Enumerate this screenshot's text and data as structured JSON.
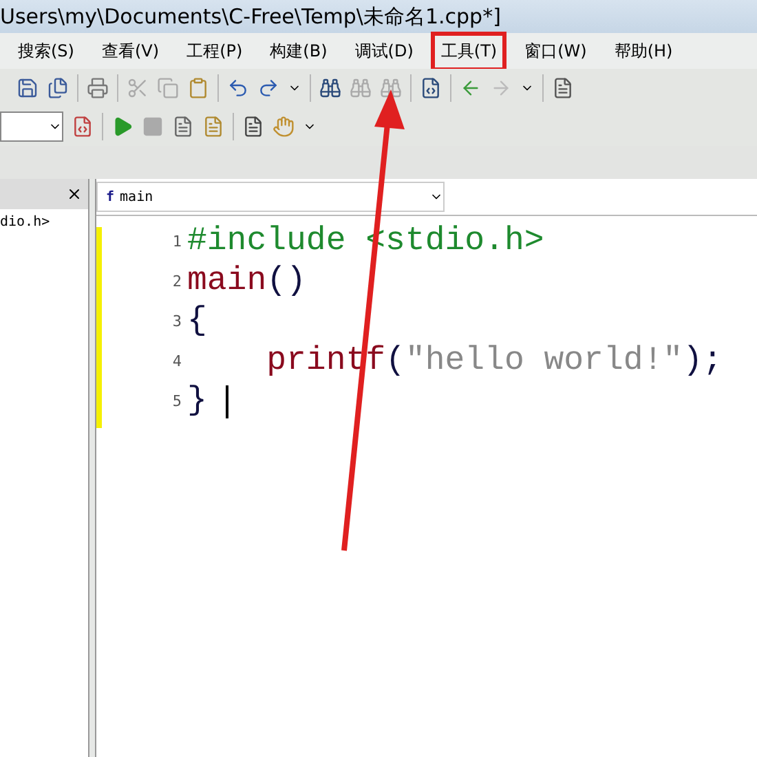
{
  "window": {
    "title": "Users\\my\\Documents\\C-Free\\Temp\\未命名1.cpp*]"
  },
  "menu": [
    {
      "label": "搜索(S)",
      "highlighted": false
    },
    {
      "label": "查看(V)",
      "highlighted": false
    },
    {
      "label": "工程(P)",
      "highlighted": false
    },
    {
      "label": "构建(B)",
      "highlighted": false
    },
    {
      "label": "调试(D)",
      "highlighted": false
    },
    {
      "label": "工具(T)",
      "highlighted": true
    },
    {
      "label": "窗口(W)",
      "highlighted": false
    },
    {
      "label": "帮助(H)",
      "highlighted": false
    }
  ],
  "left_panel": {
    "items": [
      "dio.h>"
    ]
  },
  "editor": {
    "function_icon": "f",
    "function_selector": "main",
    "lines": [
      {
        "number": "1",
        "tokens": [
          {
            "text": "#include <stdio.h>",
            "kind": "directive"
          }
        ]
      },
      {
        "number": "2",
        "tokens": [
          {
            "text": "main",
            "kind": "identifier"
          },
          {
            "text": "()",
            "kind": "punct"
          }
        ]
      },
      {
        "number": "3",
        "tokens": [
          {
            "text": "{",
            "kind": "punct"
          }
        ]
      },
      {
        "number": "4",
        "tokens": [
          {
            "text": "    printf",
            "kind": "identifier"
          },
          {
            "text": "(",
            "kind": "punct"
          },
          {
            "text": "\"hello world!\"",
            "kind": "string"
          },
          {
            "text": ");",
            "kind": "punct"
          }
        ]
      },
      {
        "number": "5",
        "tokens": [
          {
            "text": "}",
            "kind": "punct"
          }
        ],
        "cursor": true
      }
    ]
  },
  "annotation": {
    "arrow": true
  }
}
